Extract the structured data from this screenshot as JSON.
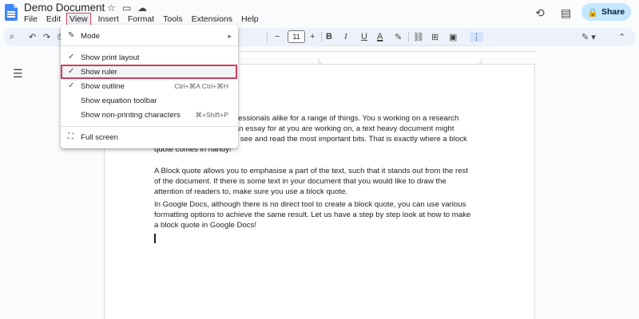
{
  "header": {
    "title": "Demo Document",
    "share_label": "Share"
  },
  "menubar": [
    "File",
    "Edit",
    "View",
    "Insert",
    "Format",
    "Tools",
    "Extensions",
    "Help"
  ],
  "toolbar": {
    "font_size": "11"
  },
  "view_menu": {
    "items": [
      {
        "label": "Mode",
        "checked": false
      },
      {
        "label": "Show print layout",
        "checked": true
      },
      {
        "label": "Show ruler",
        "checked": true,
        "highlighted": true
      },
      {
        "label": "Show outline",
        "checked": true,
        "shortcut": "Ctrl+⌘A Ctrl+⌘H"
      },
      {
        "label": "Show equation toolbar",
        "checked": false
      },
      {
        "label": "Show non-printing characters",
        "checked": false,
        "shortcut": "⌘+Shift+P"
      },
      {
        "label": "Full screen",
        "checked": false
      }
    ]
  },
  "document": {
    "paragraphs": [
      "sed by students and professionals alike for a range of things. You s working on a research paper, or simply writing an essay for at you are working on, a text heavy document might dampen your e reader to see and read the most important bits. That is exactly where a block quote comes in handy!",
      "A Block quote allows you to emphasise a part of the text, such that it stands out from the rest of the document. If there is some text in your document that you would like to draw the attention of readers to, make sure you use a block quote.",
      "In Google Docs, although there is no direct tool to create a block quote, you can use various formatting options to achieve the same result. Let us have a step by step look at how to make a block quote in Google Docs!"
    ]
  },
  "colors": {
    "highlight": "#d33a5b",
    "share_bg": "#c2e7ff",
    "doc_blue": "#4285f4"
  }
}
